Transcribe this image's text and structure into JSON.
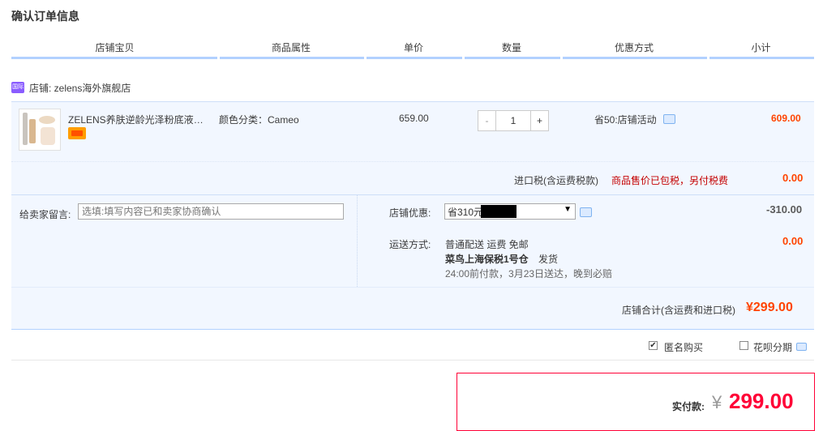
{
  "page_title": "确认订单信息",
  "columns": [
    "店铺宝贝",
    "商品属性",
    "单价",
    "数量",
    "优惠方式",
    "小计"
  ],
  "shop": {
    "icon": "tmall-global-shop-icon",
    "name": "店铺: zelens海外旗舰店"
  },
  "item": {
    "title": "ZELENS养肤逆龄光泽粉底液持久遮瑕",
    "attr": "颜色分类：Cameo",
    "price": "659.00",
    "quantity": "1",
    "minus": "-",
    "plus": "+",
    "discount": "省50:店铺活动",
    "subtotal": "609.00"
  },
  "tax": {
    "label": "进口税(含运费税款)",
    "note": "商品售价已包税，另付税费",
    "value": "0.00"
  },
  "message": {
    "label": "给卖家留言:",
    "placeholder": "选填:填写内容已和卖家协商确认"
  },
  "coupon": {
    "label": "店铺优惠:",
    "selected": "省310元:",
    "value": "-310.00"
  },
  "shipping": {
    "label": "运送方式:",
    "line1": "普通配送 运费 免邮",
    "warehouse": "菜鸟上海保税1号仓",
    "ship_note": "发货",
    "line3": "24:00前付款，3月23日送达，晚到必赔",
    "value": "0.00"
  },
  "shop_total": {
    "label": "店铺合计(含运费和进口税)",
    "value": "¥299.00"
  },
  "options": {
    "anonymous": {
      "label": "匿名购买",
      "checked": true
    },
    "huabei": {
      "label": "花呗分期",
      "checked": false
    }
  },
  "payment": {
    "label": "实付款:",
    "currency": "¥",
    "value": "299.00"
  },
  "colors": {
    "accent_blue": "#b2d1ff",
    "row_bg": "#f2f7ff",
    "price_orange": "#ff4400",
    "pay_red": "#ff0036"
  }
}
